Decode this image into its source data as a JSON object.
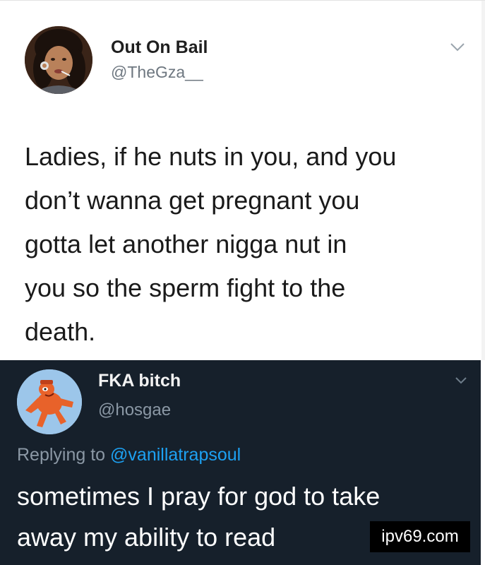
{
  "tweet_top": {
    "display_name": "Out On Bail",
    "handle": "@TheGza__",
    "avatar_icon": "profile-photo",
    "menu_icon": "chevron-down-icon",
    "body": "Ladies, if he nuts in you, and you\ndon’t wanna get pregnant you\ngotta let another nigga nut in\nyou so the sperm fight to the\ndeath.",
    "colors": {
      "background": "#ffffff",
      "name": "#1f1f1f",
      "handle": "#6e7780"
    }
  },
  "tweet_bottom": {
    "display_name": "FKA bitch",
    "handle": "@hosgae",
    "avatar_icon": "cartoon-character-avatar",
    "menu_icon": "chevron-down-icon",
    "replying_prefix": "Replying to",
    "replying_mention": "@vanillatrapsoul",
    "body": "sometimes I pray for god to take\naway my ability to read",
    "colors": {
      "background": "#16202b",
      "mention": "#1da1f2",
      "muted": "#8b98a5"
    }
  },
  "watermark": {
    "text": "ipv69.com"
  }
}
